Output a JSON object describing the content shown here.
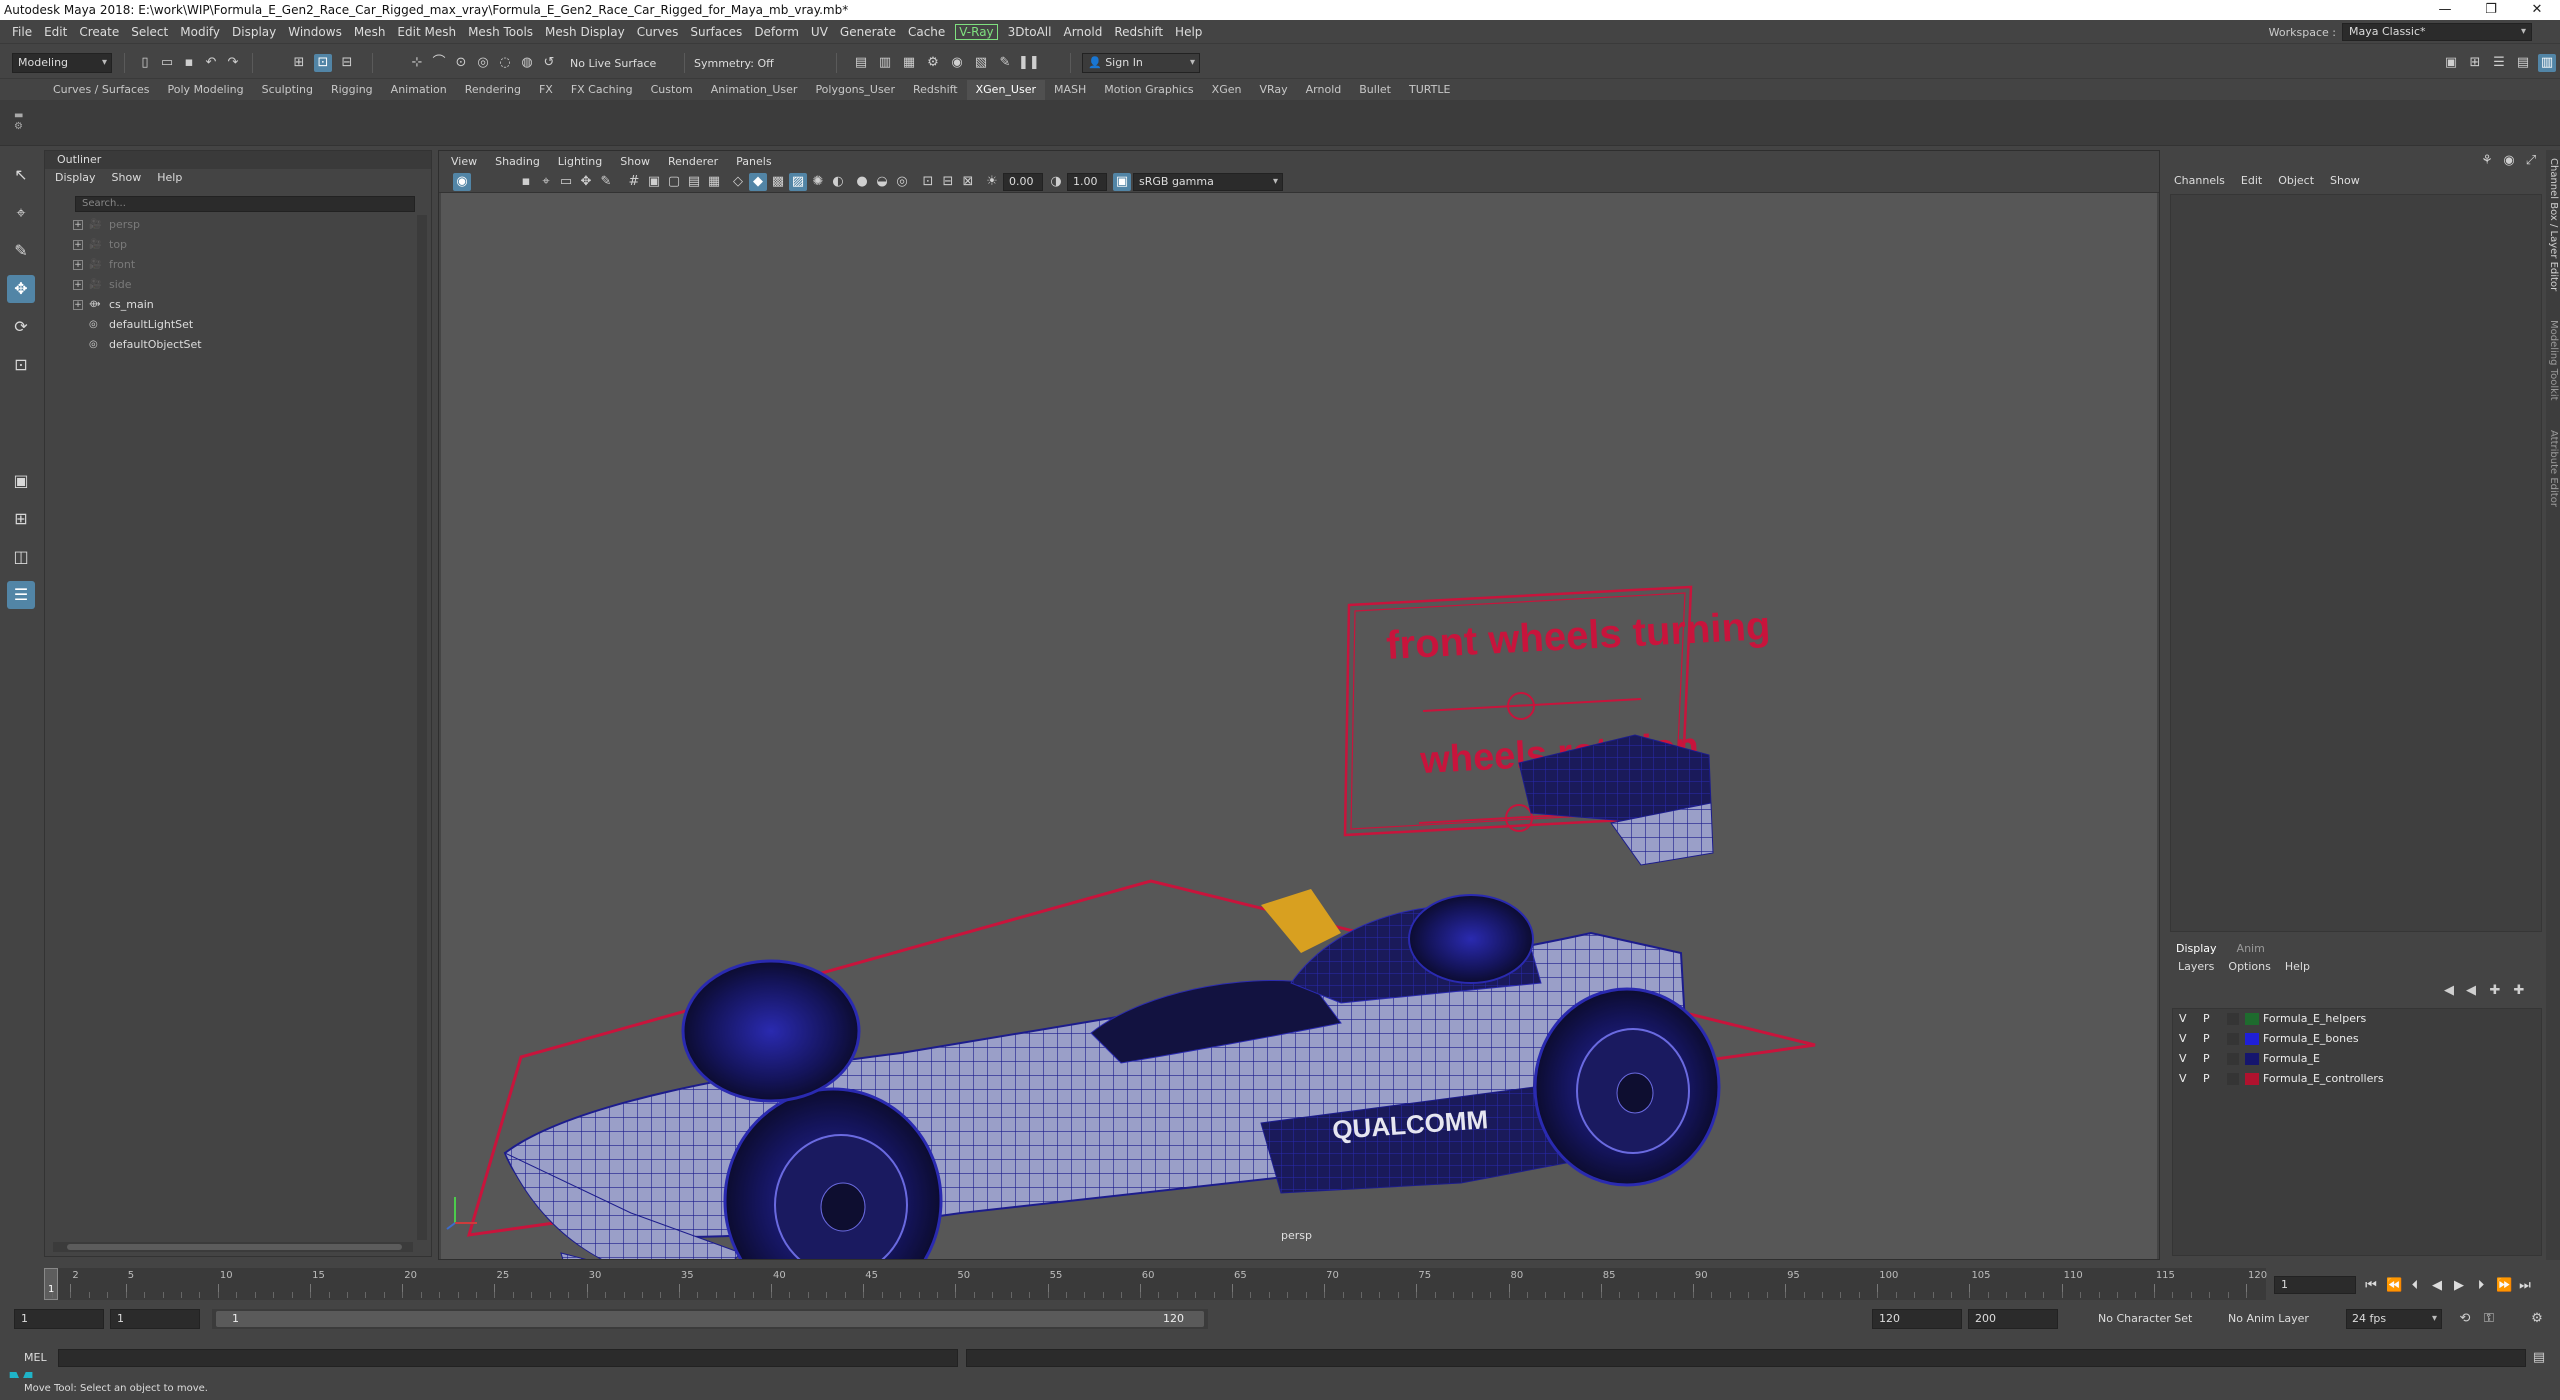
{
  "window": {
    "title": "Autodesk Maya 2018: E:\\work\\WIP\\Formula_E_Gen2_Race_Car_Rigged_max_vray\\Formula_E_Gen2_Race_Car_Rigged_for_Maya_mb_vray.mb*",
    "minimize": "—",
    "restore": "❐",
    "close": "✕"
  },
  "menubar": {
    "items": [
      "File",
      "Edit",
      "Create",
      "Select",
      "Modify",
      "Display",
      "Windows",
      "Mesh",
      "Edit Mesh",
      "Mesh Tools",
      "Mesh Display",
      "Curves",
      "Surfaces",
      "Deform",
      "UV",
      "Generate",
      "Cache",
      "V-Ray",
      "3DtoAll",
      "Arnold",
      "Redshift",
      "Help"
    ],
    "workspace_label": "Workspace :",
    "workspace_value": "Maya Classic*"
  },
  "statusline": {
    "mode": "Modeling",
    "live_surface": "No Live Surface",
    "symmetry": "Symmetry: Off",
    "sign_in": "Sign In"
  },
  "shelf": {
    "tabs": [
      "Curves / Surfaces",
      "Poly Modeling",
      "Sculpting",
      "Rigging",
      "Animation",
      "Rendering",
      "FX",
      "FX Caching",
      "Custom",
      "Animation_User",
      "Polygons_User",
      "Redshift",
      "XGen_User",
      "MASH",
      "Motion Graphics",
      "XGen",
      "VRay",
      "Arnold",
      "Bullet",
      "TURTLE"
    ],
    "active_tab": "XGen_User"
  },
  "outliner": {
    "title": "Outliner",
    "menu": [
      "Display",
      "Show",
      "Help"
    ],
    "search_placeholder": "Search...",
    "items": [
      {
        "label": "persp",
        "dim": true,
        "icon": "camera-icon",
        "expand": "+"
      },
      {
        "label": "top",
        "dim": true,
        "icon": "camera-icon",
        "expand": "+"
      },
      {
        "label": "front",
        "dim": true,
        "icon": "camera-icon",
        "expand": "+"
      },
      {
        "label": "side",
        "dim": true,
        "icon": "camera-icon",
        "expand": "+"
      },
      {
        "label": "cs_main",
        "dim": false,
        "icon": "transform-icon",
        "expand": "+"
      },
      {
        "label": "defaultLightSet",
        "dim": false,
        "icon": "set-icon",
        "expand": ""
      },
      {
        "label": "defaultObjectSet",
        "dim": false,
        "icon": "set-icon",
        "expand": ""
      }
    ]
  },
  "viewport": {
    "menu": [
      "View",
      "Shading",
      "Lighting",
      "Show",
      "Renderer",
      "Panels"
    ],
    "exposure": "0.00",
    "gamma": "1.00",
    "color_space": "sRGB gamma",
    "camera_label": "persp",
    "controls_text_1": "front wheels turning",
    "controls_text_2": "wheels rotation",
    "sponsor": "QUALCOMM",
    "accent_red": "#c8143c",
    "wire_blue": "#1c1c8c"
  },
  "channelbox": {
    "menu": [
      "Channels",
      "Edit",
      "Object",
      "Show"
    ],
    "side_tabs": [
      "Channel Box / Layer Editor",
      "Modeling Toolkit",
      "Attribute Editor"
    ]
  },
  "layereditor": {
    "tabs": [
      "Display",
      "Anim"
    ],
    "menu": [
      "Layers",
      "Options",
      "Help"
    ],
    "layers": [
      {
        "v": "V",
        "p": "P",
        "name": "Formula_E_helpers",
        "color": "#1e6b2e"
      },
      {
        "v": "V",
        "p": "P",
        "name": "Formula_E_bones",
        "color": "#1f1fd8"
      },
      {
        "v": "V",
        "p": "P",
        "name": "Formula_E",
        "color": "#15156e"
      },
      {
        "v": "V",
        "p": "P",
        "name": "Formula_E_controllers",
        "color": "#b0122e"
      }
    ]
  },
  "timeslider": {
    "marks": [
      "2",
      "5",
      "10",
      "15",
      "20",
      "25",
      "30",
      "35",
      "40",
      "45",
      "50",
      "55",
      "60",
      "65",
      "70",
      "75",
      "80",
      "85",
      "90",
      "95",
      "100",
      "105",
      "110",
      "115",
      "120"
    ],
    "current_frame": "1",
    "cursor_label": "1"
  },
  "range": {
    "start": "1",
    "playback_start": "1",
    "slider_start": "1",
    "slider_end": "120",
    "playback_end": "120",
    "end": "200",
    "character_set": "No Character Set",
    "anim_layer": "No Anim Layer",
    "fps": "24 fps"
  },
  "cmdline": {
    "label": "MEL"
  },
  "help": {
    "text": "Move Tool: Select an object to move."
  }
}
